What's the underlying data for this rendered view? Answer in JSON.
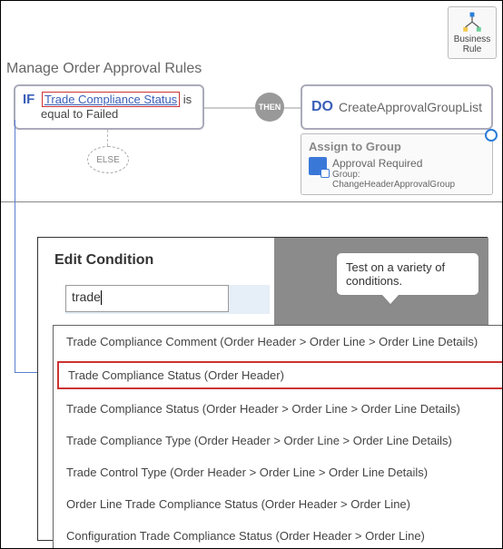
{
  "title": "Manage Order Approval Rules",
  "businessRule": {
    "label_line1": "Business",
    "label_line2": "Rule"
  },
  "if": {
    "kw": "IF",
    "clause_part1": "Trade Compliance Status",
    "clause_part2": "is",
    "clause_line2": "equal to Failed"
  },
  "else_label": "ELSE",
  "then_label": "THEN",
  "do": {
    "kw": "DO",
    "action": "CreateApprovalGroupList"
  },
  "assign": {
    "header": "Assign to Group",
    "line1": "Approval Required",
    "line2": "Group: ChangeHeaderApprovalGroup"
  },
  "editCondition": {
    "title": "Edit Condition",
    "search_value": "trade"
  },
  "tooltip": "Test on a variety of conditions.",
  "dropdown": {
    "items": [
      "Trade Compliance Comment (Order Header > Order Line > Order Line Details)",
      "Trade Compliance Status (Order Header)",
      "Trade Compliance Status (Order Header > Order Line > Order Line Details)",
      "Trade Compliance Type (Order Header > Order Line > Order Line Details)",
      "Trade Control Type (Order Header > Order Line > Order Line Details)",
      "Order Line Trade Compliance Status (Order Header > Order Line)",
      "Configuration Trade Compliance Status (Order Header > Order Line)"
    ],
    "selected_index": 1
  }
}
